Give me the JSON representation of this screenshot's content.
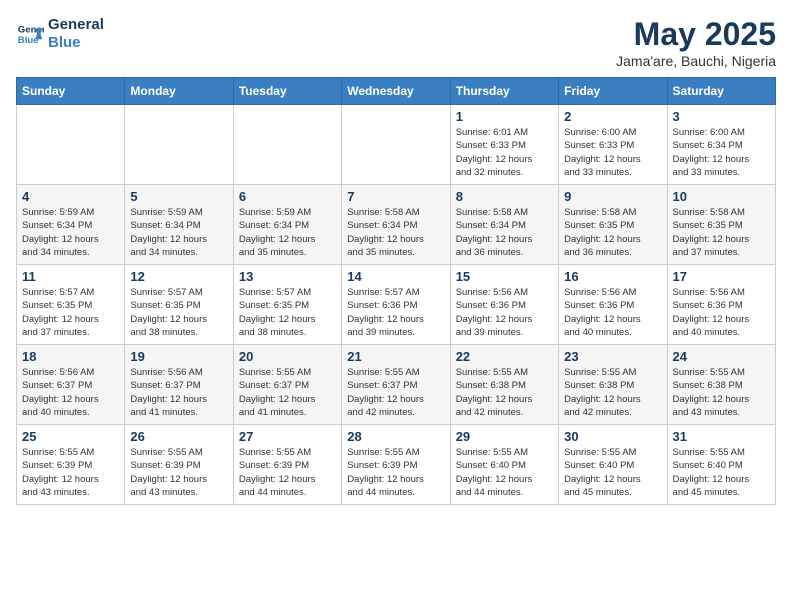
{
  "header": {
    "logo_line1": "General",
    "logo_line2": "Blue",
    "month": "May 2025",
    "location": "Jama'are, Bauchi, Nigeria"
  },
  "weekdays": [
    "Sunday",
    "Monday",
    "Tuesday",
    "Wednesday",
    "Thursday",
    "Friday",
    "Saturday"
  ],
  "weeks": [
    [
      {
        "day": "",
        "info": ""
      },
      {
        "day": "",
        "info": ""
      },
      {
        "day": "",
        "info": ""
      },
      {
        "day": "",
        "info": ""
      },
      {
        "day": "1",
        "info": "Sunrise: 6:01 AM\nSunset: 6:33 PM\nDaylight: 12 hours\nand 32 minutes."
      },
      {
        "day": "2",
        "info": "Sunrise: 6:00 AM\nSunset: 6:33 PM\nDaylight: 12 hours\nand 33 minutes."
      },
      {
        "day": "3",
        "info": "Sunrise: 6:00 AM\nSunset: 6:34 PM\nDaylight: 12 hours\nand 33 minutes."
      }
    ],
    [
      {
        "day": "4",
        "info": "Sunrise: 5:59 AM\nSunset: 6:34 PM\nDaylight: 12 hours\nand 34 minutes."
      },
      {
        "day": "5",
        "info": "Sunrise: 5:59 AM\nSunset: 6:34 PM\nDaylight: 12 hours\nand 34 minutes."
      },
      {
        "day": "6",
        "info": "Sunrise: 5:59 AM\nSunset: 6:34 PM\nDaylight: 12 hours\nand 35 minutes."
      },
      {
        "day": "7",
        "info": "Sunrise: 5:58 AM\nSunset: 6:34 PM\nDaylight: 12 hours\nand 35 minutes."
      },
      {
        "day": "8",
        "info": "Sunrise: 5:58 AM\nSunset: 6:34 PM\nDaylight: 12 hours\nand 36 minutes."
      },
      {
        "day": "9",
        "info": "Sunrise: 5:58 AM\nSunset: 6:35 PM\nDaylight: 12 hours\nand 36 minutes."
      },
      {
        "day": "10",
        "info": "Sunrise: 5:58 AM\nSunset: 6:35 PM\nDaylight: 12 hours\nand 37 minutes."
      }
    ],
    [
      {
        "day": "11",
        "info": "Sunrise: 5:57 AM\nSunset: 6:35 PM\nDaylight: 12 hours\nand 37 minutes."
      },
      {
        "day": "12",
        "info": "Sunrise: 5:57 AM\nSunset: 6:35 PM\nDaylight: 12 hours\nand 38 minutes."
      },
      {
        "day": "13",
        "info": "Sunrise: 5:57 AM\nSunset: 6:35 PM\nDaylight: 12 hours\nand 38 minutes."
      },
      {
        "day": "14",
        "info": "Sunrise: 5:57 AM\nSunset: 6:36 PM\nDaylight: 12 hours\nand 39 minutes."
      },
      {
        "day": "15",
        "info": "Sunrise: 5:56 AM\nSunset: 6:36 PM\nDaylight: 12 hours\nand 39 minutes."
      },
      {
        "day": "16",
        "info": "Sunrise: 5:56 AM\nSunset: 6:36 PM\nDaylight: 12 hours\nand 40 minutes."
      },
      {
        "day": "17",
        "info": "Sunrise: 5:56 AM\nSunset: 6:36 PM\nDaylight: 12 hours\nand 40 minutes."
      }
    ],
    [
      {
        "day": "18",
        "info": "Sunrise: 5:56 AM\nSunset: 6:37 PM\nDaylight: 12 hours\nand 40 minutes."
      },
      {
        "day": "19",
        "info": "Sunrise: 5:56 AM\nSunset: 6:37 PM\nDaylight: 12 hours\nand 41 minutes."
      },
      {
        "day": "20",
        "info": "Sunrise: 5:55 AM\nSunset: 6:37 PM\nDaylight: 12 hours\nand 41 minutes."
      },
      {
        "day": "21",
        "info": "Sunrise: 5:55 AM\nSunset: 6:37 PM\nDaylight: 12 hours\nand 42 minutes."
      },
      {
        "day": "22",
        "info": "Sunrise: 5:55 AM\nSunset: 6:38 PM\nDaylight: 12 hours\nand 42 minutes."
      },
      {
        "day": "23",
        "info": "Sunrise: 5:55 AM\nSunset: 6:38 PM\nDaylight: 12 hours\nand 42 minutes."
      },
      {
        "day": "24",
        "info": "Sunrise: 5:55 AM\nSunset: 6:38 PM\nDaylight: 12 hours\nand 43 minutes."
      }
    ],
    [
      {
        "day": "25",
        "info": "Sunrise: 5:55 AM\nSunset: 6:39 PM\nDaylight: 12 hours\nand 43 minutes."
      },
      {
        "day": "26",
        "info": "Sunrise: 5:55 AM\nSunset: 6:39 PM\nDaylight: 12 hours\nand 43 minutes."
      },
      {
        "day": "27",
        "info": "Sunrise: 5:55 AM\nSunset: 6:39 PM\nDaylight: 12 hours\nand 44 minutes."
      },
      {
        "day": "28",
        "info": "Sunrise: 5:55 AM\nSunset: 6:39 PM\nDaylight: 12 hours\nand 44 minutes."
      },
      {
        "day": "29",
        "info": "Sunrise: 5:55 AM\nSunset: 6:40 PM\nDaylight: 12 hours\nand 44 minutes."
      },
      {
        "day": "30",
        "info": "Sunrise: 5:55 AM\nSunset: 6:40 PM\nDaylight: 12 hours\nand 45 minutes."
      },
      {
        "day": "31",
        "info": "Sunrise: 5:55 AM\nSunset: 6:40 PM\nDaylight: 12 hours\nand 45 minutes."
      }
    ]
  ]
}
